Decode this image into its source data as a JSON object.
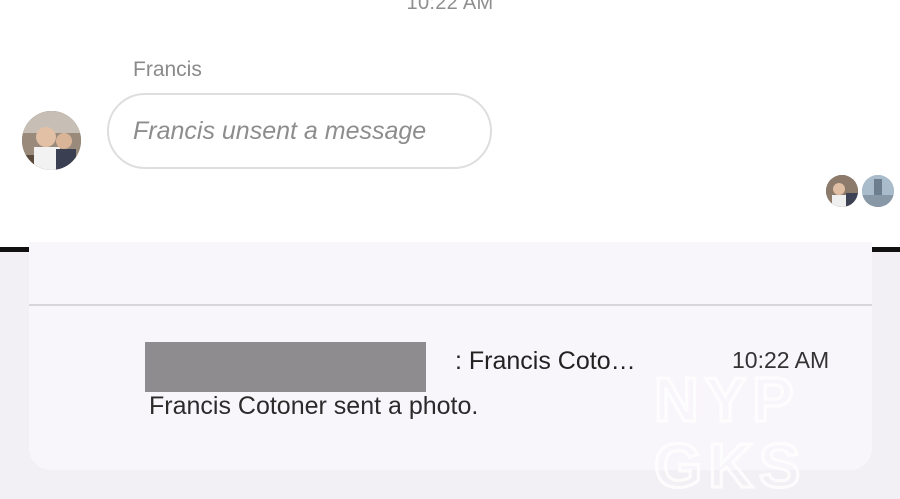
{
  "chat": {
    "timestamp": "10:22 AM",
    "sender_name": "Francis",
    "message_text": "Francis unsent a message",
    "avatar_icon": "user-avatar-photo",
    "read_receipt_icons": [
      "read-receipt-avatar",
      "read-receipt-avatar"
    ]
  },
  "notification": {
    "title": ": Francis Coto…",
    "time": "10:22 AM",
    "body": "Francis Cotoner sent a photo."
  },
  "watermark": {
    "logo_text_line1": "NYP",
    "logo_text_line2": "GKS"
  },
  "colors": {
    "bubble_border": "#dedede",
    "notification_bg": "#f9f6fb",
    "redaction": "#8e8c8f",
    "divider": "#111111"
  }
}
